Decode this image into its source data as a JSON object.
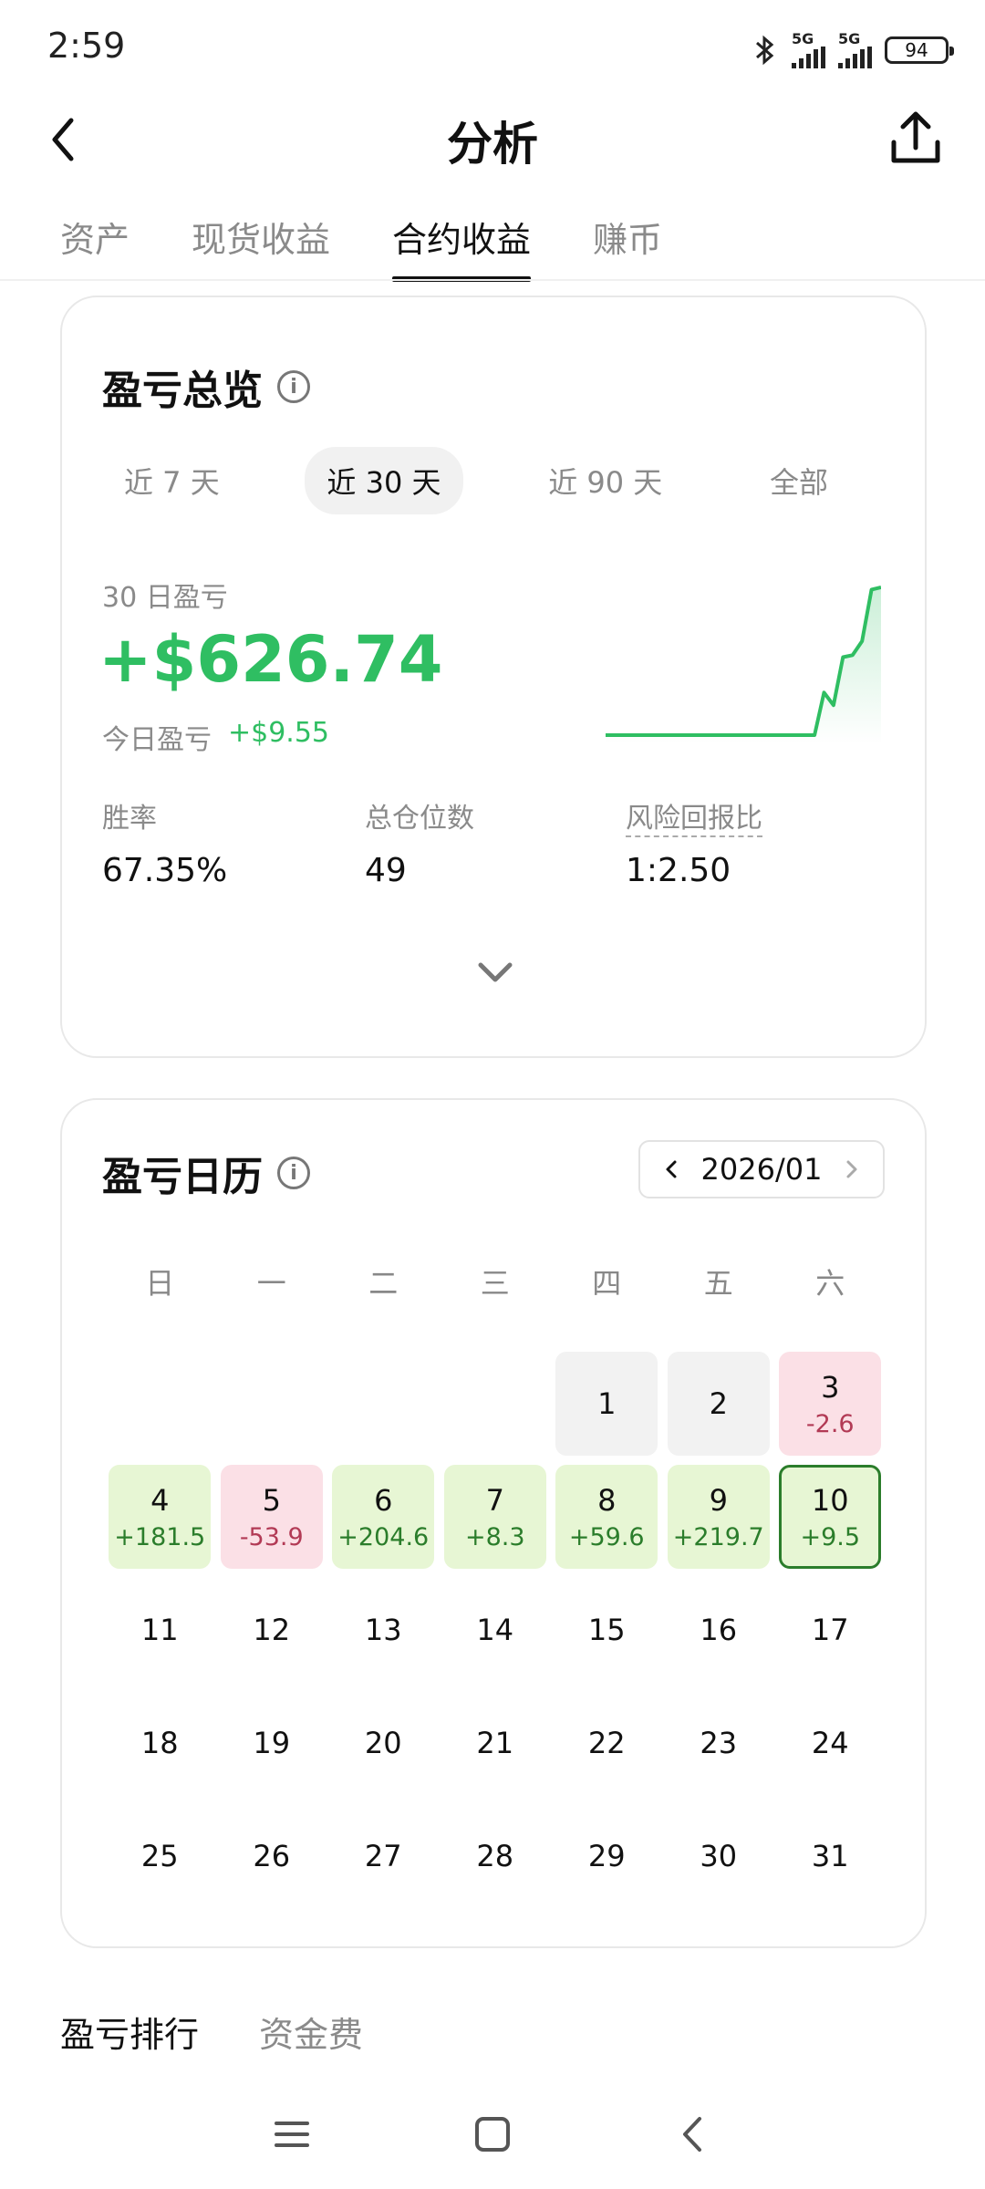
{
  "status_bar": {
    "time": "2:59",
    "signal1_label": "5G",
    "signal2_label": "5G",
    "battery": "94",
    "icons": [
      "bluetooth-icon",
      "signal-icon",
      "battery-icon"
    ]
  },
  "header": {
    "title": "分析",
    "back_icon": "chevron-left-icon",
    "share_icon": "share-icon"
  },
  "tabs": [
    {
      "label": "资产",
      "active": false
    },
    {
      "label": "现货收益",
      "active": false
    },
    {
      "label": "合约收益",
      "active": true
    },
    {
      "label": "赚币",
      "active": false
    }
  ],
  "overview": {
    "title": "盈亏总览",
    "periods": [
      {
        "label": "近 7 天",
        "active": false
      },
      {
        "label": "近 30 天",
        "active": true
      },
      {
        "label": "近 90 天",
        "active": false
      },
      {
        "label": "全部",
        "active": false
      }
    ],
    "pnl_label": "30 日盈亏",
    "pnl_value": "+$626.74",
    "today_label": "今日盈亏",
    "today_value": "+$9.55",
    "stats": [
      {
        "label": "胜率",
        "value": "67.35%"
      },
      {
        "label": "总仓位数",
        "value": "49"
      },
      {
        "label": "风险回报比",
        "value": "1:2.50"
      }
    ],
    "sparkline": [
      0,
      0,
      0,
      0,
      0,
      0,
      0,
      0,
      0,
      0,
      0,
      0,
      0,
      0,
      0,
      0,
      0,
      0,
      0,
      0,
      0,
      0,
      0,
      181.5,
      127.6,
      332.2,
      340.5,
      400.1,
      619.8,
      629.3
    ],
    "accent_color": "#2fbe62"
  },
  "calendar": {
    "title": "盈亏日历",
    "month": "2026/01",
    "weekdays": [
      "日",
      "一",
      "二",
      "三",
      "四",
      "五",
      "六"
    ],
    "first_weekday": 4,
    "days": [
      {
        "d": "1",
        "v": "",
        "kind": "grey"
      },
      {
        "d": "2",
        "v": "",
        "kind": "grey"
      },
      {
        "d": "3",
        "v": "-2.6",
        "kind": "neg"
      },
      {
        "d": "4",
        "v": "+181.5",
        "kind": "pos"
      },
      {
        "d": "5",
        "v": "-53.9",
        "kind": "neg"
      },
      {
        "d": "6",
        "v": "+204.6",
        "kind": "pos"
      },
      {
        "d": "7",
        "v": "+8.3",
        "kind": "pos"
      },
      {
        "d": "8",
        "v": "+59.6",
        "kind": "pos"
      },
      {
        "d": "9",
        "v": "+219.7",
        "kind": "pos"
      },
      {
        "d": "10",
        "v": "+9.5",
        "kind": "today"
      },
      {
        "d": "11",
        "v": "",
        "kind": ""
      },
      {
        "d": "12",
        "v": "",
        "kind": ""
      },
      {
        "d": "13",
        "v": "",
        "kind": ""
      },
      {
        "d": "14",
        "v": "",
        "kind": ""
      },
      {
        "d": "15",
        "v": "",
        "kind": ""
      },
      {
        "d": "16",
        "v": "",
        "kind": ""
      },
      {
        "d": "17",
        "v": "",
        "kind": ""
      },
      {
        "d": "18",
        "v": "",
        "kind": ""
      },
      {
        "d": "19",
        "v": "",
        "kind": ""
      },
      {
        "d": "20",
        "v": "",
        "kind": ""
      },
      {
        "d": "21",
        "v": "",
        "kind": ""
      },
      {
        "d": "22",
        "v": "",
        "kind": ""
      },
      {
        "d": "23",
        "v": "",
        "kind": ""
      },
      {
        "d": "24",
        "v": "",
        "kind": ""
      },
      {
        "d": "25",
        "v": "",
        "kind": ""
      },
      {
        "d": "26",
        "v": "",
        "kind": ""
      },
      {
        "d": "27",
        "v": "",
        "kind": ""
      },
      {
        "d": "28",
        "v": "",
        "kind": ""
      },
      {
        "d": "29",
        "v": "",
        "kind": ""
      },
      {
        "d": "30",
        "v": "",
        "kind": ""
      },
      {
        "d": "31",
        "v": "",
        "kind": ""
      }
    ],
    "colors": {
      "positive_bg": "#e7f6d4",
      "positive_text": "#2b7d2b",
      "negative_bg": "#fbe0e6",
      "negative_text": "#b23a55"
    }
  },
  "bottom_tabs": [
    {
      "label": "盈亏排行",
      "active": true
    },
    {
      "label": "资金费",
      "active": false
    }
  ],
  "nav_icons": [
    "menu-icon",
    "home-icon",
    "back-icon"
  ]
}
